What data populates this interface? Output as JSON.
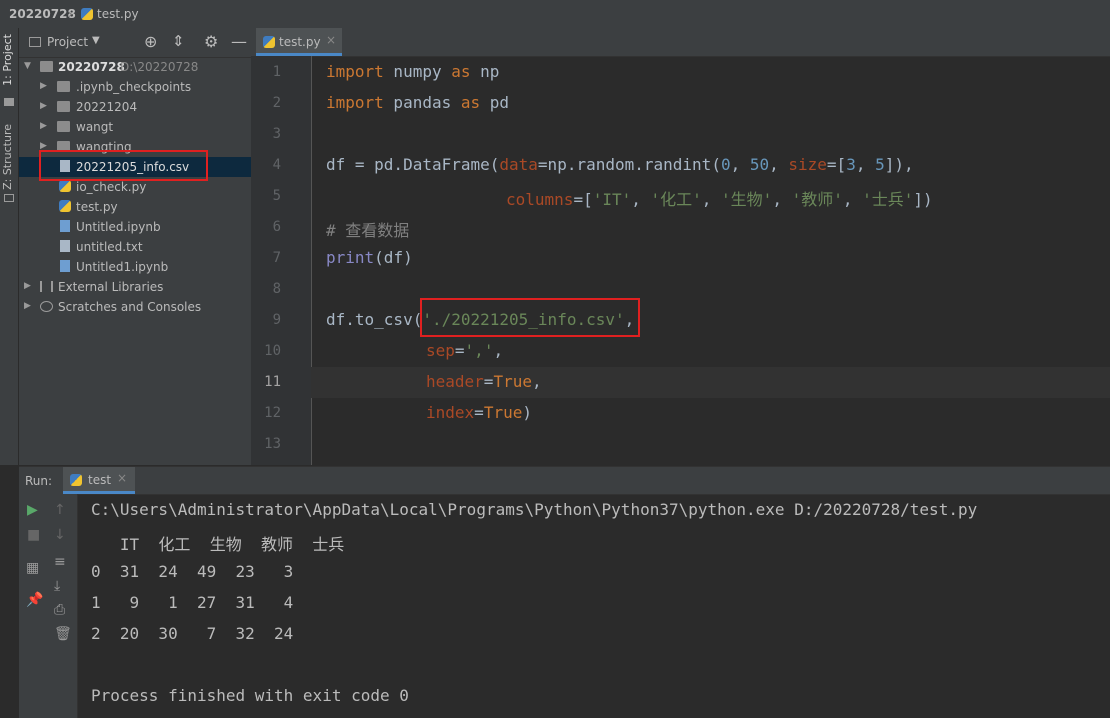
{
  "breadcrumb": {
    "project": "20220728",
    "file": "test.py"
  },
  "sidebar_tabs": {
    "project": "1: Project",
    "structure": "Z: Structure"
  },
  "project_panel": {
    "title": "Project",
    "root": {
      "name": "20220728",
      "path": "D:\\20220728"
    },
    "items": [
      {
        "label": ".ipynb_checkpoints"
      },
      {
        "label": "20221204"
      },
      {
        "label": "wangt"
      },
      {
        "label": "wangting"
      },
      {
        "label": "20221205_info.csv"
      },
      {
        "label": "io_check.py"
      },
      {
        "label": "test.py"
      },
      {
        "label": "Untitled.ipynb"
      },
      {
        "label": "untitled.txt"
      },
      {
        "label": "Untitled1.ipynb"
      },
      {
        "label": "External Libraries"
      },
      {
        "label": "Scratches and Consoles"
      }
    ]
  },
  "editor": {
    "tab_label": "test.py",
    "line_numbers": [
      "1",
      "2",
      "3",
      "4",
      "5",
      "6",
      "7",
      "8",
      "9",
      "10",
      "11",
      "12",
      "13"
    ],
    "code": {
      "l1_kw1": "import",
      "l1_rest1": " numpy ",
      "l1_kw2": "as",
      "l1_rest2": " np",
      "l2_kw1": "import",
      "l2_rest1": " pandas ",
      "l2_kw2": "as",
      "l2_rest2": " pd",
      "l4_a": "df = pd.DataFrame(",
      "l4_p1": "data",
      "l4_b": "=np.random.randint(",
      "l4_n1": "0",
      "l4_c": ", ",
      "l4_n2": "50",
      "l4_d": ", ",
      "l4_p2": "size",
      "l4_e": "=[",
      "l4_n3": "3",
      "l4_f": ", ",
      "l4_n4": "5",
      "l4_g": "]),",
      "l5_p": "columns",
      "l5_a": "=[",
      "l5_s1": "'IT'",
      "l5_c1": ", ",
      "l5_s2": "'化工'",
      "l5_c2": ", ",
      "l5_s3": "'生物'",
      "l5_c3": ", ",
      "l5_s4": "'教师'",
      "l5_c4": ", ",
      "l5_s5": "'士兵'",
      "l5_b": "])",
      "l6_comment": "# 查看数据",
      "l7_fn": "print",
      "l7_rest": "(df)",
      "l9_a": "df.to_csv(",
      "l9_s": "'./20221205_info.csv'",
      "l9_b": ",",
      "l10_p": "sep",
      "l10_a": "=",
      "l10_s": "','",
      "l10_b": ",",
      "l11_p": "header",
      "l11_a": "=",
      "l11_k": "True",
      "l11_b": ",",
      "l12_p": "index",
      "l12_a": "=",
      "l12_k": "True",
      "l12_b": ")"
    }
  },
  "run_panel": {
    "label": "Run:",
    "tab_label": "test",
    "output_lines": [
      "C:\\Users\\Administrator\\AppData\\Local\\Programs\\Python\\Python37\\python.exe D:/20220728/test.py",
      "   IT  化工  生物  教师  士兵",
      "0  31  24  49  23   3",
      "1   9   1  27  31   4",
      "2  20  30   7  32  24",
      "",
      "Process finished with exit code 0"
    ]
  },
  "colors": {
    "accent": "#4a88c7",
    "highlight_box": "#e02020",
    "keyword": "#cc7832",
    "string": "#6a8759",
    "number": "#6897bb"
  }
}
